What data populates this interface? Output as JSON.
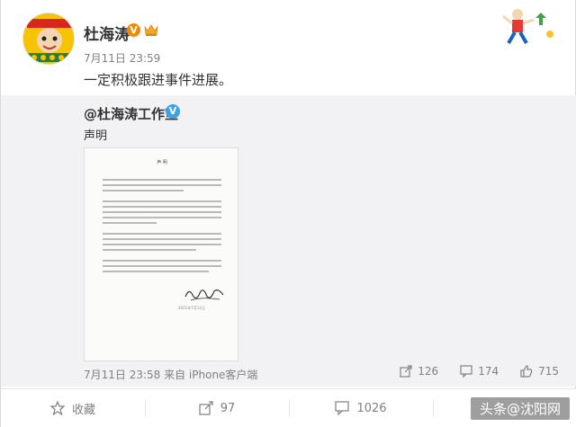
{
  "post": {
    "author": "杜海涛",
    "timestamp": "7月11日 23:59",
    "text": "一定积极跟进事件进展。",
    "avatar_icon": "cartoon-avatar-icon",
    "crown_icon": "crown-badge-icon"
  },
  "repost": {
    "author": "@杜海涛工作室",
    "text": "声明",
    "document": {
      "title": "声 明",
      "date": "2021年7月11日"
    },
    "footer": "7月11日 23:58 来自 iPhone客户端",
    "stats": [
      {
        "icon": "share-icon",
        "value": "126"
      },
      {
        "icon": "comment-icon",
        "value": "174"
      },
      {
        "icon": "like-icon",
        "value": "715"
      }
    ]
  },
  "actions": [
    {
      "icon": "star-icon",
      "label": "收藏"
    },
    {
      "icon": "share-icon",
      "label": "97"
    },
    {
      "icon": "comment-icon",
      "label": "1026"
    }
  ],
  "watermark": "头条@沈阳网",
  "colors": {
    "accent_orange": "#f28a00",
    "verified_blue": "#3fa1ea",
    "repost_bg": "#f2f2f5",
    "muted_text": "#808080"
  }
}
